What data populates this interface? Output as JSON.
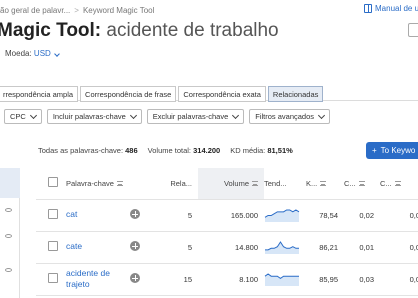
{
  "breadcrumb": {
    "item1": "ão geral de palavr...",
    "separator": ">",
    "item2": "Keyword Magic Tool"
  },
  "manual_link": "Manual de us",
  "title": {
    "tool": "Magic Tool:",
    "keyword": "acidente de trabalho"
  },
  "currency": {
    "label": "Moeda:",
    "value": "USD"
  },
  "tabs": [
    {
      "label": "rrespondência ampla",
      "active": false
    },
    {
      "label": "Correspondência de frase",
      "active": false
    },
    {
      "label": "Correspondência exata",
      "active": false
    },
    {
      "label": "Relacionadas",
      "active": true
    }
  ],
  "filters": [
    "CPC",
    "Incluir palavras-chave",
    "Excluir palavras-chave",
    "Filtros avançados"
  ],
  "stats": {
    "all_label": "Todas as palavras-chave:",
    "all_value": "486",
    "volume_label": "Volume total:",
    "volume_value": "314.200",
    "kd_label": "KD média:",
    "kd_value": "81,51%"
  },
  "export_button": "To Keywo",
  "table": {
    "headers": [
      "Palavra-chave",
      "Rela...",
      "Volume",
      "Tend...",
      "K...",
      "C...",
      "C..."
    ],
    "rows": [
      {
        "keyword": "cat",
        "related": "5",
        "volume": "165.000",
        "trend": [
          2,
          3,
          3,
          4,
          5,
          5,
          5,
          6,
          6,
          5,
          6,
          5
        ],
        "kd": "78,54",
        "cpc": "0,02",
        "com": "0,0"
      },
      {
        "keyword": "cate",
        "related": "5",
        "volume": "14.800",
        "trend": [
          2,
          2,
          3,
          3,
          4,
          7,
          4,
          3,
          3,
          4,
          3,
          3
        ],
        "kd": "86,21",
        "cpc": "0,01",
        "com": "0,0"
      },
      {
        "keyword": "acidente de trajeto",
        "related": "15",
        "volume": "8.100",
        "trend": [
          4,
          5,
          4,
          4,
          4,
          3,
          4,
          4,
          4,
          4,
          4,
          4
        ],
        "kd": "85,95",
        "cpc": "0,03",
        "com": "0,0"
      }
    ]
  },
  "colors": {
    "accent": "#2a6cc7",
    "active_tab": "#e6ecf5"
  }
}
